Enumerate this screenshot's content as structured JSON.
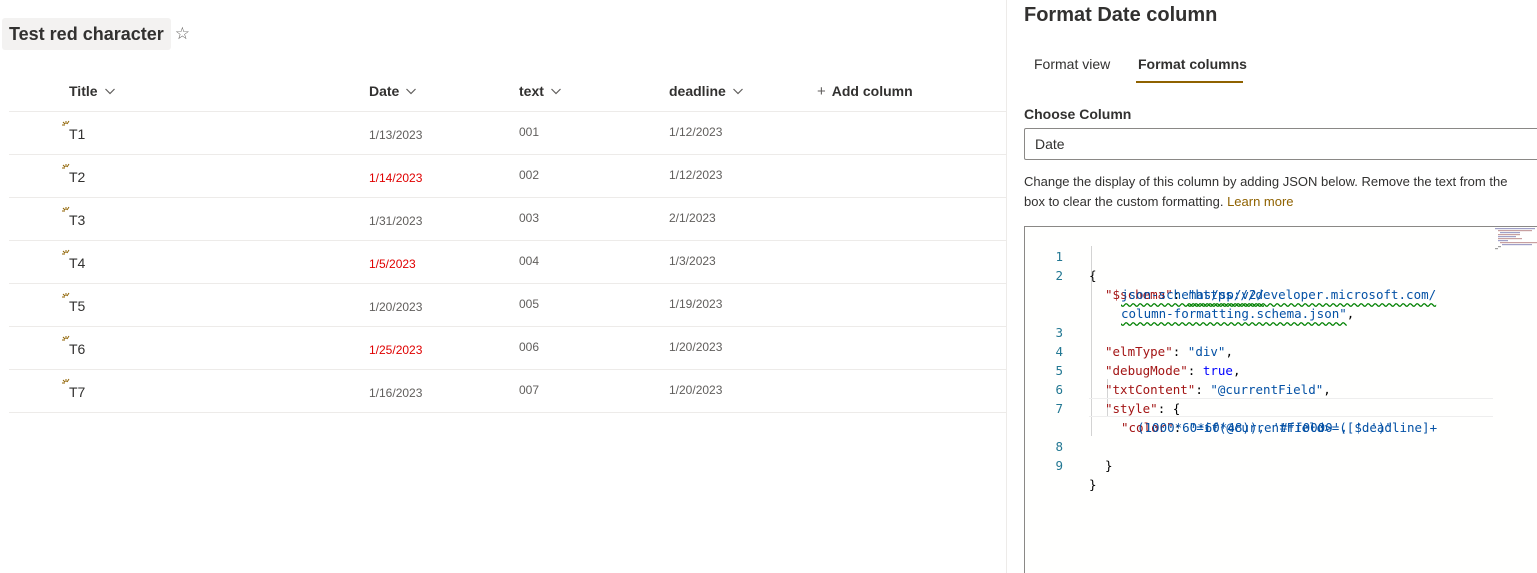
{
  "list": {
    "title": "Test red character",
    "columns": [
      {
        "label": "Title"
      },
      {
        "label": "Date"
      },
      {
        "label": "text"
      },
      {
        "label": "deadline"
      }
    ],
    "add_column_label": "Add column",
    "rows": [
      {
        "title": "T1",
        "date": "1/13/2023",
        "text": "001",
        "deadline": "1/12/2023",
        "date_red": false
      },
      {
        "title": "T2",
        "date": "1/14/2023",
        "text": "002",
        "deadline": "1/12/2023",
        "date_red": true
      },
      {
        "title": "T3",
        "date": "1/31/2023",
        "text": "003",
        "deadline": "2/1/2023",
        "date_red": false
      },
      {
        "title": "T4",
        "date": "1/5/2023",
        "text": "004",
        "deadline": "1/3/2023",
        "date_red": true
      },
      {
        "title": "T5",
        "date": "1/20/2023",
        "text": "005",
        "deadline": "1/19/2023",
        "date_red": false
      },
      {
        "title": "T6",
        "date": "1/25/2023",
        "text": "006",
        "deadline": "1/20/2023",
        "date_red": true
      },
      {
        "title": "T7",
        "date": "1/16/2023",
        "text": "007",
        "deadline": "1/20/2023",
        "date_red": false
      }
    ]
  },
  "panel": {
    "title": "Format Date column",
    "tabs": [
      {
        "label": "Format view",
        "selected": false
      },
      {
        "label": "Format columns",
        "selected": true
      }
    ],
    "choose_column_label": "Choose Column",
    "selected_column": "Date",
    "description_line1": "Change the display of this column by adding JSON below. Remove the text from the",
    "description_line2": "box to clear the custom formatting.",
    "learn_more": "Learn more",
    "code": {
      "line_numbers": [
        "1",
        "2",
        "3",
        "4",
        "5",
        "6",
        "7",
        "8",
        "9"
      ],
      "open_brace": "{",
      "schema_key": "\"$schema\"",
      "schema_url_1": "\"https://developer.microsoft.com/",
      "schema_url_2": "json-schemas/sp/v2/",
      "schema_url_3": "column-formatting.schema.json\"",
      "elm_key": "\"elmType\"",
      "elm_val": "\"div\"",
      "debug_key": "\"debugMode\"",
      "debug_val": "true",
      "txt_key": "\"txtContent\"",
      "txt_val": "\"@currentField\"",
      "style_key": "\"style\"",
      "color_key": "\"color\"",
      "color_val_1": "\"=if(@currentField>=([$deadline]+",
      "color_val_2": "(1000*60*60*48)), '#ff0000', ' ')\"",
      "close_inner": "}",
      "close_outer": "}"
    }
  },
  "colors": {
    "accent": "#8f6200",
    "red_date": "#e00000",
    "border": "#edebe9"
  },
  "icons": {
    "star": "star-outline-icon",
    "chevron": "chevron-down-icon",
    "plus": "plus-icon",
    "new_item": "new-item-sparkle-icon"
  }
}
